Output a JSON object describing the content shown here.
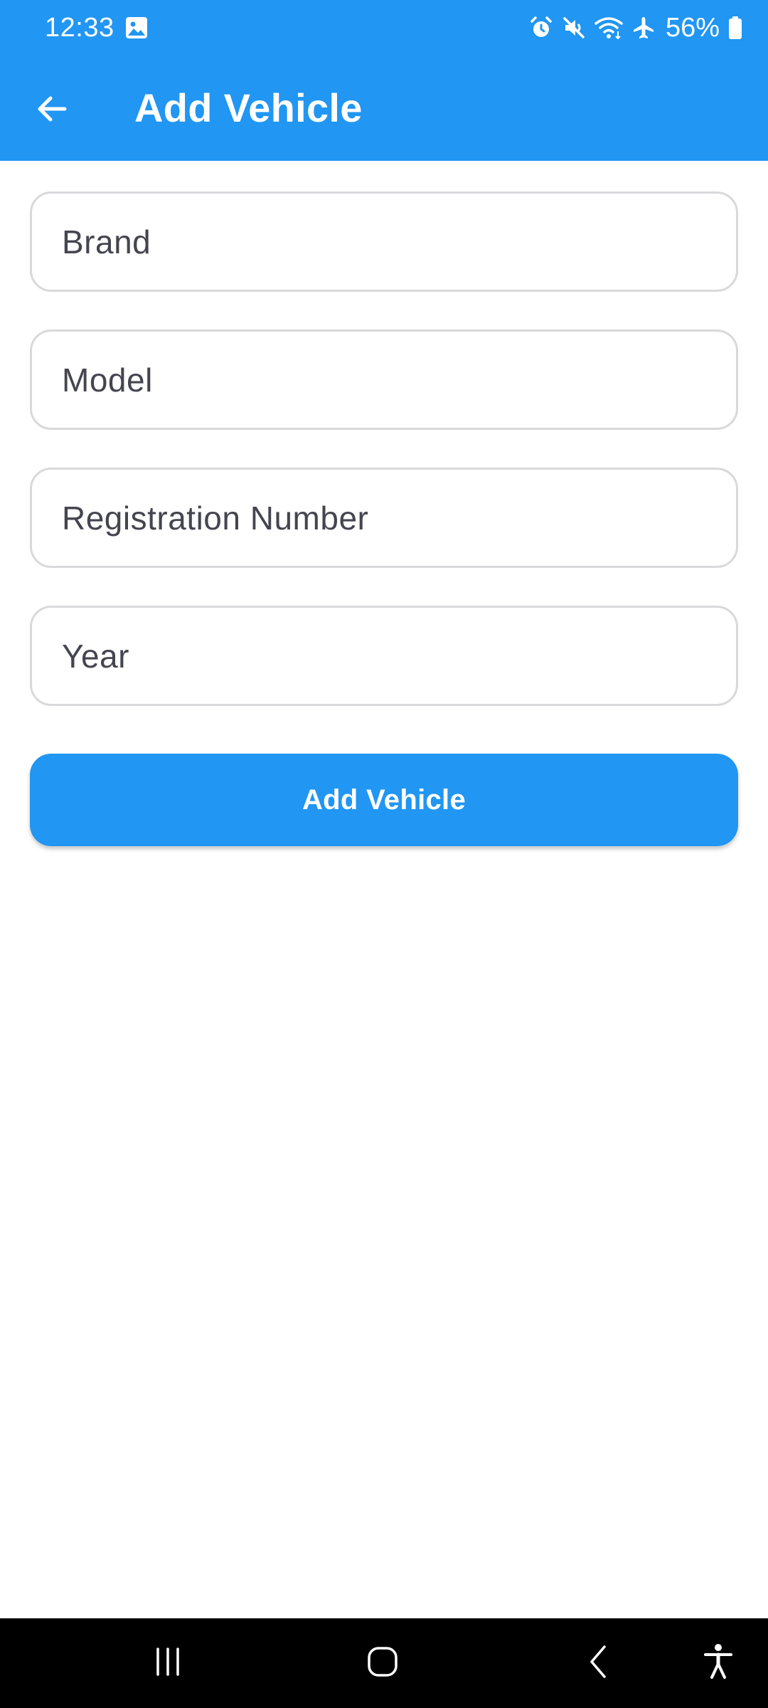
{
  "status_bar": {
    "time": "12:33",
    "battery": "56%",
    "icons": [
      "gallery-icon",
      "alarm-icon",
      "mute-icon",
      "wifi-icon",
      "airplane-mode-icon",
      "battery-icon"
    ]
  },
  "app_bar": {
    "title": "Add Vehicle",
    "back_icon": "arrow-left-icon"
  },
  "form": {
    "brand_placeholder": "Brand",
    "brand_value": "",
    "model_placeholder": "Model",
    "model_value": "",
    "registration_placeholder": "Registration Number",
    "registration_value": "",
    "year_placeholder": "Year",
    "year_value": "",
    "submit_label": "Add Vehicle"
  },
  "nav_bar": {
    "icons": [
      "recents-icon",
      "home-icon",
      "back-icon",
      "accessibility-icon"
    ]
  },
  "colors": {
    "primary": "#2196f3",
    "on_primary": "#ffffff",
    "field_border": "#d9d9dc",
    "placeholder_text": "#45454f",
    "nav_background": "#000000"
  }
}
